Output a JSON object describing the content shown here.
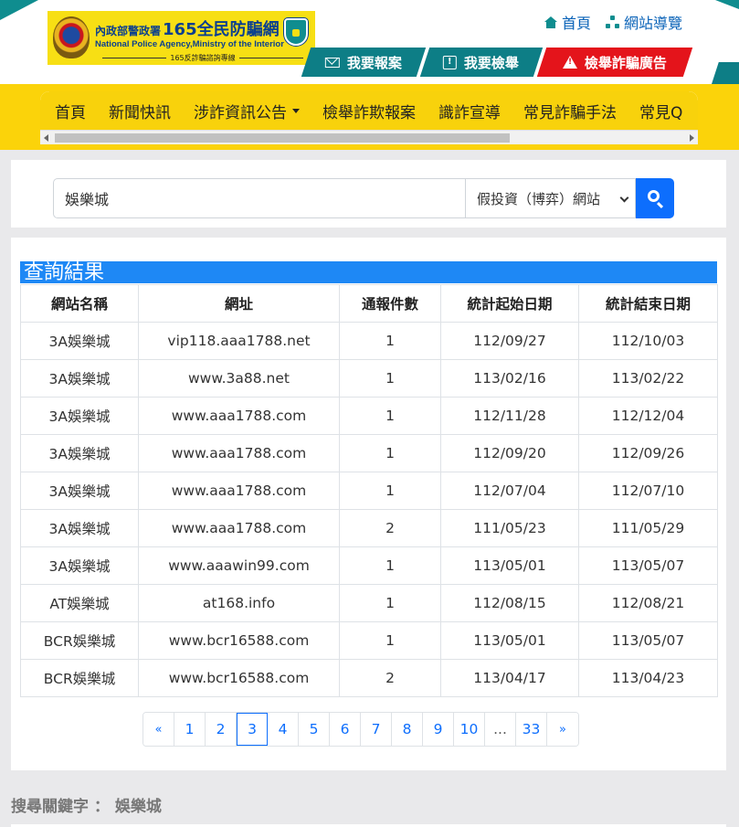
{
  "logo": {
    "title_small": "內政部警政署",
    "title_big": "165全民防騙網",
    "subtitle_en": "National Police Agency,Ministry of the Interior",
    "hotline": "165反詐騙諮詢專線"
  },
  "top_links": {
    "home": "首頁",
    "sitemap": "網站導覽"
  },
  "header_buttons": {
    "report": "我要報案",
    "tipoff": "我要檢舉",
    "report_ad": "檢舉詐騙廣告"
  },
  "nav": {
    "items": [
      "首頁",
      "新聞快訊",
      "涉詐資訊公告",
      "檢舉詐欺報案",
      "識詐宣導",
      "常見詐騙手法",
      "常見Q"
    ]
  },
  "search": {
    "value": "娛樂城",
    "category": "假投資（博弈）網站"
  },
  "results": {
    "title": "查詢結果",
    "headers": [
      "網站名稱",
      "網址",
      "通報件數",
      "統計起始日期",
      "統計結束日期"
    ],
    "rows": [
      [
        "3A娛樂城",
        "vip118.aaa1788.net",
        "1",
        "112/09/27",
        "112/10/03"
      ],
      [
        "3A娛樂城",
        "www.3a88.net",
        "1",
        "113/02/16",
        "113/02/22"
      ],
      [
        "3A娛樂城",
        "www.aaa1788.com",
        "1",
        "112/11/28",
        "112/12/04"
      ],
      [
        "3A娛樂城",
        "www.aaa1788.com",
        "1",
        "112/09/20",
        "112/09/26"
      ],
      [
        "3A娛樂城",
        "www.aaa1788.com",
        "1",
        "112/07/04",
        "112/07/10"
      ],
      [
        "3A娛樂城",
        "www.aaa1788.com",
        "2",
        "111/05/23",
        "111/05/29"
      ],
      [
        "3A娛樂城",
        "www.aaawin99.com",
        "1",
        "113/05/01",
        "113/05/07"
      ],
      [
        "AT娛樂城",
        "at168.info",
        "1",
        "112/08/15",
        "112/08/21"
      ],
      [
        "BCR娛樂城",
        "www.bcr16588.com",
        "1",
        "113/05/01",
        "113/05/07"
      ],
      [
        "BCR娛樂城",
        "www.bcr16588.com",
        "2",
        "113/04/17",
        "113/04/23"
      ]
    ]
  },
  "pagination": {
    "prev": "«",
    "pages": [
      "1",
      "2",
      "3",
      "4",
      "5",
      "6",
      "7",
      "8",
      "9",
      "10"
    ],
    "current": "3",
    "ellipsis": "...",
    "last": "33",
    "next": "»"
  },
  "keyword": {
    "label": "搜尋關鍵字 ：",
    "value": "娛樂城"
  },
  "colors": {
    "yellow": "#fbd30a",
    "teal": "#0d7e86",
    "red": "#e4141b",
    "blue": "#1e88f5",
    "link_blue": "#0d6efd"
  }
}
